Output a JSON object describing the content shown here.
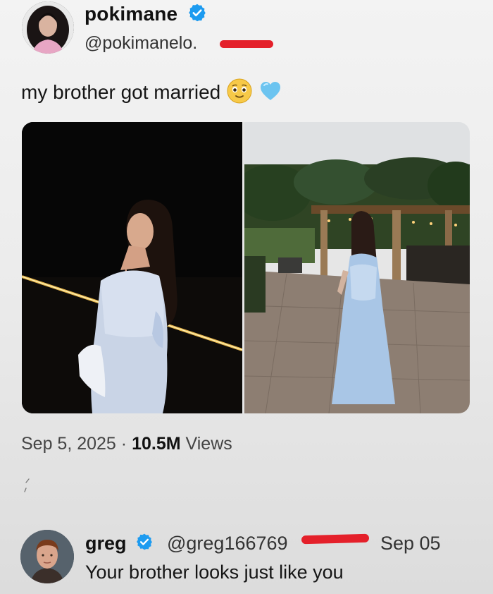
{
  "post": {
    "display_name": "pokimane",
    "handle": "@pokimanelo.",
    "text": "my brother got married",
    "emojis": [
      "smiling-face-with-tear-eyes-emoji",
      "light-blue-heart-emoji"
    ],
    "date": "Sep 5, 2025",
    "separator": "·",
    "views_count": "10.5M",
    "views_label": "Views"
  },
  "reply": {
    "display_name": "greg",
    "handle": "@greg166769",
    "date": "Sep 05",
    "text": "Your brother looks just like you"
  },
  "colors": {
    "verified": "#1d9bf0",
    "redaction": "#e4202a",
    "dress": "#a9c6e6"
  }
}
